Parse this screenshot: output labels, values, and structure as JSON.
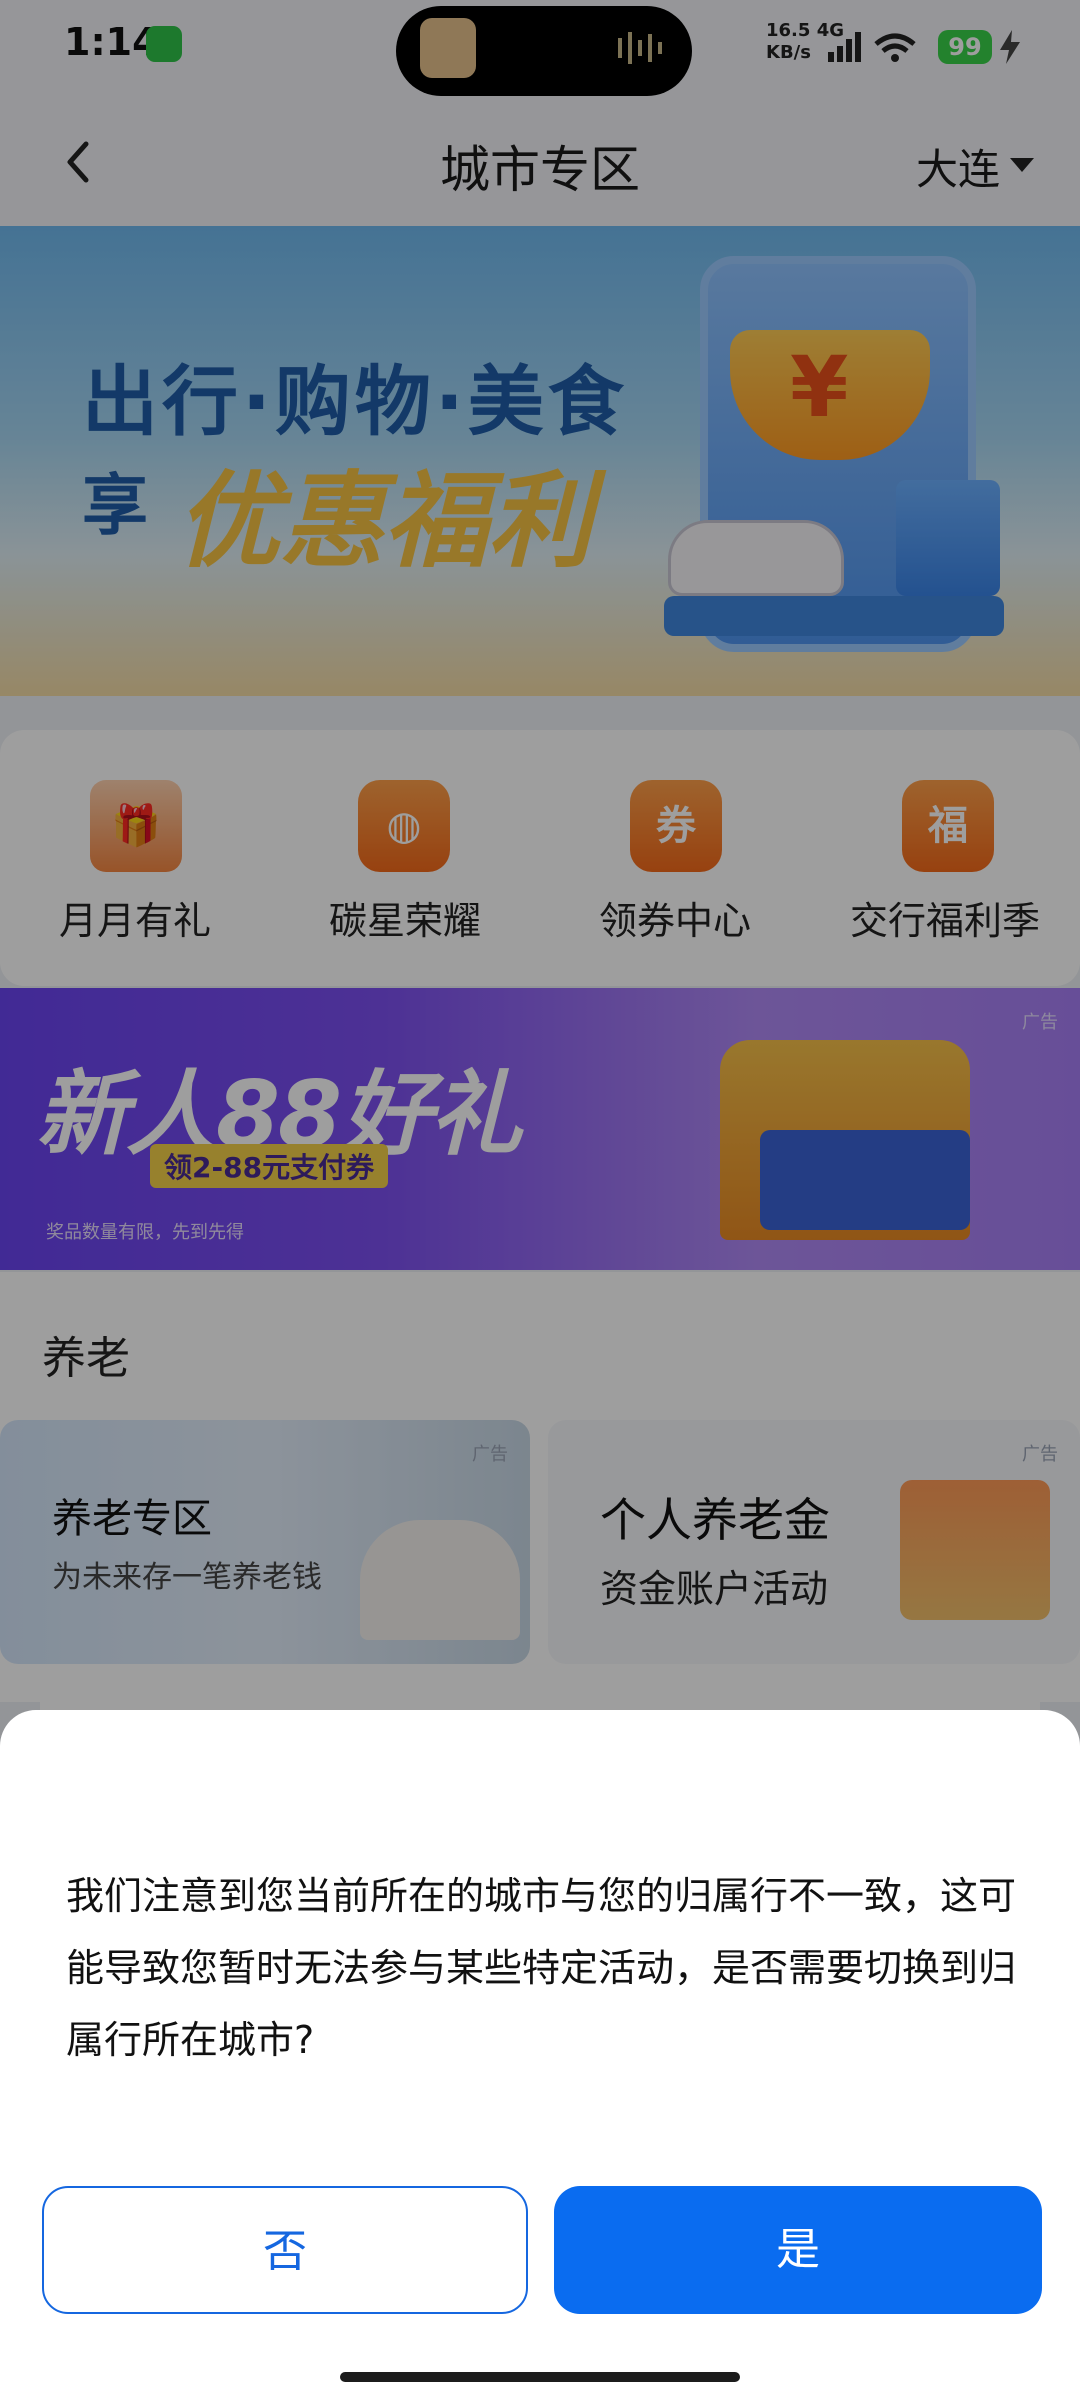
{
  "status_bar": {
    "time": "1:14",
    "net_speed_value": "16.5",
    "net_type": "4G",
    "net_speed_unit": "KB/s",
    "battery": "99"
  },
  "header": {
    "title": "城市专区",
    "city": "大连"
  },
  "banner": {
    "line1": "出行·购物·美食",
    "line2_prefix": "享",
    "line2_highlight": "优惠福利",
    "currency_symbol": "¥"
  },
  "quick_menu": [
    {
      "label": "月月有礼",
      "icon": "gift-box-icon",
      "glyph": "🎁"
    },
    {
      "label": "碳星荣耀",
      "icon": "earth-leaf-icon",
      "glyph": "◍"
    },
    {
      "label": "领券中心",
      "icon": "coupon-icon",
      "glyph": "券"
    },
    {
      "label": "交行福利季",
      "icon": "fu-icon",
      "glyph": "福"
    }
  ],
  "ad_88": {
    "title": "新人88好礼",
    "subtitle": "领2-88元支付券",
    "note": "奖品数量有限，先到先得",
    "tag": "广告"
  },
  "pension": {
    "section_title": "养老",
    "card1": {
      "title": "养老专区",
      "subtitle": "为未来存一笔养老钱",
      "tag": "广告"
    },
    "card2": {
      "title": "个人养老金",
      "subtitle": "资金账户活动",
      "tag": "广告"
    }
  },
  "dialog": {
    "message": "我们注意到您当前所在的城市与您的归属行不一致，这可能导致您暂时无法参与某些特定活动，是否需要切换到归属行所在城市?",
    "no_label": "否",
    "yes_label": "是"
  },
  "colors": {
    "primary": "#0a6cf0",
    "accent_orange": "#f46a1a",
    "ad_purple": "#7c4ff0"
  }
}
